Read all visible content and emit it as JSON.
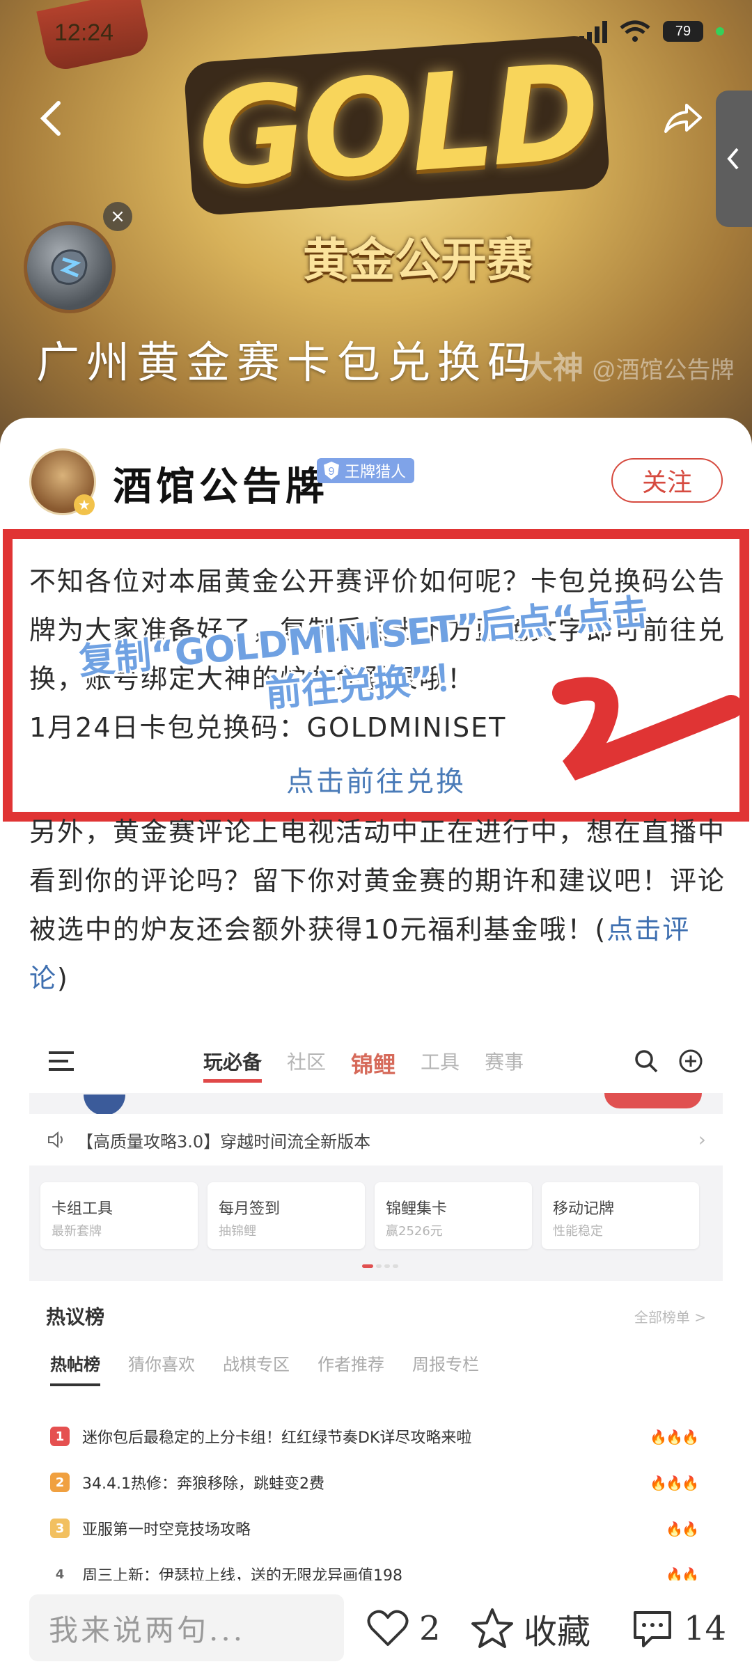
{
  "status_bar": {
    "time": "12:24",
    "network": "5G",
    "battery": "79"
  },
  "hero": {
    "logo_text": "GOLD",
    "subtitle": "黄金公开赛",
    "title": "广州黄金赛卡包兑换码",
    "watermark_brand": "大神",
    "watermark_handle": "@酒馆公告牌",
    "close_symbol": "×"
  },
  "author": {
    "name": "酒馆公告牌",
    "badge_level": "9",
    "badge_text": "王牌猎人",
    "follow_label": "关注"
  },
  "post": {
    "para1": "不知各位对本届黄金公开赛评价如何呢？卡包兑换码公告牌为大家准备好了，复制后点击下方蓝色文字即可前往兑换，账号绑定大神的炉友免登录哦！",
    "code_line": "1月24日卡包兑换码：GOLDMINISET",
    "exchange_link": "点击前往兑换",
    "para2_text": "另外，黄金赛评论上电视活动中正在进行中，想在直播中看到你的评论吗？留下你对黄金赛的期许和建议吧！评论被选中的炉友还会额外获得10元福利基金哦！(",
    "para2_link": "点击评论",
    "para2_end": ")",
    "annotation_line1": "复制“GOLDMINISET”后点“点击",
    "annotation_line2": "前往兑换”！"
  },
  "embed": {
    "tabs": [
      "玩必备",
      "社区",
      "锦鲤",
      "工具",
      "赛事"
    ],
    "notice": "【高质量攻略3.0】穿越时间流全新版本",
    "quick_cards": [
      {
        "title": "卡组工具",
        "sub": "最新套牌"
      },
      {
        "title": "每月签到",
        "sub": "抽锦鲤"
      },
      {
        "title": "锦鲤集卡",
        "sub": "赢2526元"
      },
      {
        "title": "移动记牌",
        "sub": "性能稳定"
      }
    ],
    "hot_title": "热议榜",
    "hot_all": "全部榜单 >",
    "hot_tabs": [
      "热帖榜",
      "猜你喜欢",
      "战棋专区",
      "作者推荐",
      "周报专栏"
    ],
    "hot_items": [
      {
        "rank": "1",
        "text": "迷你包后最稳定的上分卡组！红红绿节奏DK详尽攻略来啦",
        "heat": "🔥🔥🔥"
      },
      {
        "rank": "2",
        "text": "34.4.1热修：奔狼移除，跳蛙变2费",
        "heat": "🔥🔥🔥"
      },
      {
        "rank": "3",
        "text": "亚服第一时空竞技场攻略",
        "heat": "🔥🔥"
      },
      {
        "rank": "4",
        "text": "周三上新：伊瑟拉上线，送的无限龙异画值198",
        "heat": "🔥🔥"
      }
    ]
  },
  "bottom_bar": {
    "comment_placeholder": "我来说两句...",
    "like_count": "2",
    "favorite_label": "收藏",
    "comment_count": "14"
  },
  "colors": {
    "accent_red": "#e03434",
    "link_blue": "#4a7bb8",
    "annotation_blue": "#6fa1e2",
    "badge_blue": "#7fa3e8"
  }
}
